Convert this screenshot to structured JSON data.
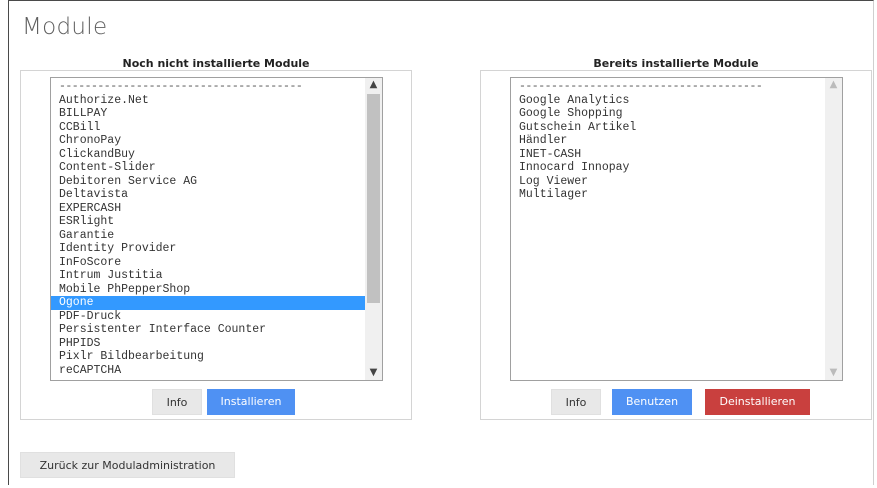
{
  "page": {
    "title": "Module"
  },
  "left": {
    "heading": "Noch nicht installierte Module",
    "separator": "--------------------------------------",
    "items": [
      "Authorize.Net",
      "BILLPAY",
      "CCBill",
      "ChronoPay",
      "ClickandBuy",
      "Content-Slider",
      "Debitoren Service AG",
      "Deltavista",
      "EXPERCASH",
      "ESRlight",
      "Garantie",
      "Identity Provider",
      "InFoScore",
      "Intrum Justitia",
      "Mobile PhPepperShop",
      "Ogone",
      "PDF-Druck",
      "Persistenter Interface Counter",
      "PHPIDS",
      "Pixlr Bildbearbeitung",
      "reCAPTCHA"
    ],
    "selected_item": "Ogone",
    "buttons": {
      "info": "Info",
      "install": "Installieren"
    }
  },
  "right": {
    "heading": "Bereits installierte Module",
    "separator": "--------------------------------------",
    "items": [
      "Google Analytics",
      "Google Shopping",
      "Gutschein Artikel",
      "Händler",
      "INET-CASH",
      "Innocard Innopay",
      "Log Viewer",
      "Multilager"
    ],
    "buttons": {
      "info": "Info",
      "use": "Benutzen",
      "uninstall": "Deinstallieren"
    }
  },
  "footer": {
    "back_label": "Zurück zur Moduladministration"
  },
  "icons": {
    "scroll_up": "chevron-up-icon",
    "scroll_down": "chevron-down-icon"
  },
  "colors": {
    "primary": "#4f91f3",
    "danger": "#c9403e",
    "selection": "#3399ff"
  }
}
